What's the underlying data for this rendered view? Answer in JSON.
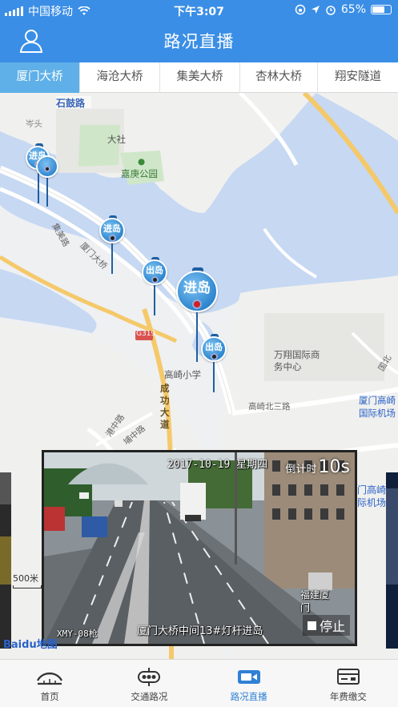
{
  "status_bar": {
    "carrier": "中国移动",
    "time": "下午3:07",
    "battery": "65%"
  },
  "header": {
    "title": "路况直播",
    "user_icon": "user-icon"
  },
  "tabs": [
    {
      "label": "厦门大桥",
      "active": true
    },
    {
      "label": "海沧大桥",
      "active": false
    },
    {
      "label": "集美大桥",
      "active": false
    },
    {
      "label": "杏林大桥",
      "active": false
    },
    {
      "label": "翔安隧道",
      "active": false
    }
  ],
  "map": {
    "labels": {
      "shigu": "石鼓路",
      "cenTou": "岑头",
      "dashe": "大社",
      "jiageng": "嘉庚公园",
      "jimei_rd": "集美路",
      "xiamen_bridge": "厦门大桥",
      "g319": "G319",
      "gaoqi_school": "高崎小学",
      "chenggong": "成功大道",
      "wanxiang": "万翔国际商务中心",
      "gaoqi_north3": "高崎北三路",
      "gangzhong": "港中路",
      "buzhong": "埔中路",
      "xiamen_airport": "厦门高崎国际机场",
      "guobei": "国北",
      "scale": "500米",
      "baidu_logo": "Baidu地图"
    },
    "markers": [
      {
        "label": "进岛",
        "type": "entry"
      },
      {
        "label": "进岛",
        "type": "entry"
      },
      {
        "label": "出岛",
        "type": "exit"
      },
      {
        "label": "进岛",
        "type": "entry",
        "selected": true
      },
      {
        "label": "出岛",
        "type": "exit"
      }
    ]
  },
  "video": {
    "timestamp": "2017-10-19 星期四",
    "countdown_prefix": "倒计时",
    "countdown_value": "10s",
    "camera_id": "XMY-08枪",
    "caption": "厦门大桥中间13#灯杆进岛",
    "overlay_city": "福建厦门",
    "stop_label": "停止"
  },
  "side_right_text": "门高崎际机场",
  "bottom_nav": [
    {
      "label": "首页",
      "icon": "home-bridge-icon",
      "active": false
    },
    {
      "label": "交通路况",
      "icon": "traffic-light-icon",
      "active": false
    },
    {
      "label": "路况直播",
      "icon": "video-camera-icon",
      "active": true
    },
    {
      "label": "年费缴交",
      "icon": "payment-card-icon",
      "active": false
    }
  ],
  "colors": {
    "header": "#3a8ee6",
    "tab_active": "#5fb0e8",
    "water": "#c6d8f2",
    "nav_active": "#2f80d6"
  }
}
